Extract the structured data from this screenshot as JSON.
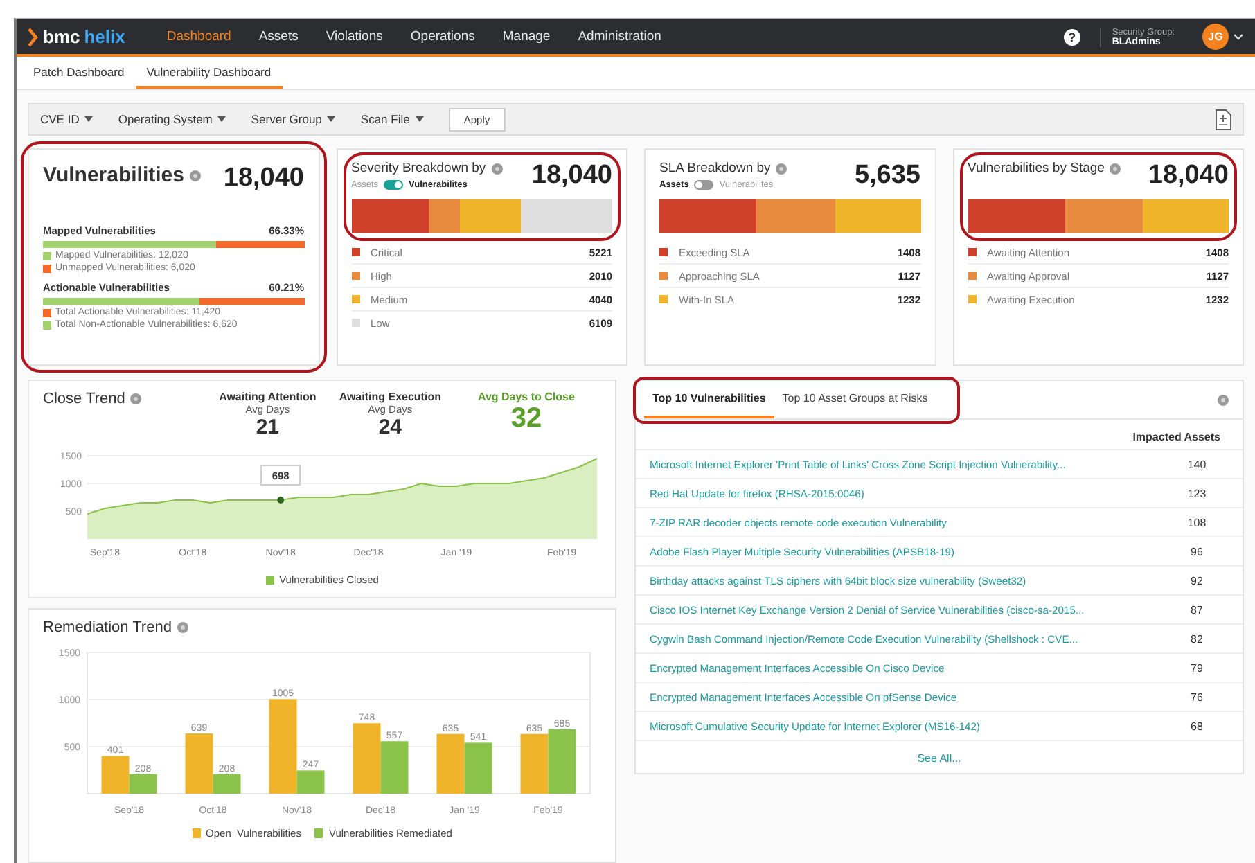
{
  "header": {
    "logo": {
      "brand": "bmc",
      "product": "helix"
    },
    "nav": [
      {
        "label": "Dashboard",
        "selected": true
      },
      {
        "label": "Assets",
        "selected": false
      },
      {
        "label": "Violations",
        "selected": false
      },
      {
        "label": "Operations",
        "selected": false
      },
      {
        "label": "Manage",
        "selected": false
      },
      {
        "label": "Administration",
        "selected": false
      }
    ],
    "help": "?",
    "security_group": {
      "label": "Security Group:",
      "value": "BLAdmins"
    },
    "avatar": "JG"
  },
  "subtabs": [
    {
      "label": "Patch Dashboard",
      "selected": false
    },
    {
      "label": "Vulnerability Dashboard",
      "selected": true
    }
  ],
  "filters": [
    {
      "label": "CVE ID"
    },
    {
      "label": "Operating System"
    },
    {
      "label": "Server Group"
    },
    {
      "label": "Scan File"
    }
  ],
  "apply": "Apply",
  "cards": [
    {
      "kind": "summary",
      "title": "Vulnerabilities",
      "total": "18,040",
      "highlighted": true,
      "sections": [
        {
          "title": "Mapped Vulnerabilities",
          "percent": "66.33%",
          "level": 0.6633,
          "legend": [
            {
              "label": "Mapped Vulnerabilities: 12,020",
              "color": "#a3d16e"
            },
            {
              "label": "Unmapped Vulnerabilities: 6,020",
              "color": "#f26b2a"
            }
          ]
        },
        {
          "title": "Actionable Vulnerabilities",
          "percent": "60.21%",
          "level": 0.6021,
          "legend": [
            {
              "label": "Total Actionable Vulnerabilities: 11,420",
              "color": "#f26b2a"
            },
            {
              "label": "Total Non-Actionable Vulnerabilities: 6,620",
              "color": "#a3d16e"
            }
          ]
        }
      ]
    },
    {
      "kind": "breakdown",
      "title": "Severity Breakdown by",
      "total": "18,040",
      "highlighted": true,
      "toggle": {
        "left": "Assets",
        "right": "Vulnerabilites",
        "on": true
      },
      "segments": [
        {
          "label": "Critical",
          "count": "5221",
          "color": "#d0402a"
        },
        {
          "label": "High",
          "count": "2010",
          "color": "#e88b3f"
        },
        {
          "label": "Medium",
          "count": "4040",
          "color": "#efb429"
        },
        {
          "label": "Low",
          "count": "6109",
          "color": "#dedede"
        }
      ]
    },
    {
      "kind": "breakdown",
      "title": "SLA Breakdown by",
      "total": "5,635",
      "highlighted": false,
      "toggle": {
        "left": "Assets",
        "right": "Vulnerabilites",
        "on": false
      },
      "segments": [
        {
          "label": "Exceeding SLA",
          "count": "1408",
          "color": "#d0402a"
        },
        {
          "label": "Approaching SLA",
          "count": "1127",
          "color": "#e88b3f"
        },
        {
          "label": "With-In SLA",
          "count": "1232",
          "color": "#efb429"
        }
      ]
    },
    {
      "kind": "breakdown",
      "title": "Vulnerabilities by Stage",
      "total": "18,040",
      "highlighted": true,
      "segments": [
        {
          "label": "Awaiting Attention",
          "count": "1408",
          "color": "#d0402a"
        },
        {
          "label": "Awaiting Approval",
          "count": "1127",
          "color": "#e88b3f"
        },
        {
          "label": "Awaiting Execution",
          "count": "1232",
          "color": "#efb429"
        }
      ]
    }
  ],
  "close_trend": {
    "title": "Close Trend",
    "stats": [
      {
        "kind": "plain",
        "label": "Awaiting Attention",
        "sublabel": "Avg Days",
        "value": "21"
      },
      {
        "kind": "plain",
        "label": "Awaiting Execution",
        "sublabel": "Avg Days",
        "value": "24"
      },
      {
        "kind": "accent",
        "label": "Avg Days to Close",
        "value": "32"
      }
    ],
    "chart_data": {
      "type": "area",
      "categories": [
        null,
        "Sep'18",
        null,
        null,
        null,
        null,
        "Oct'18",
        null,
        null,
        null,
        null,
        "Nov'18",
        null,
        null,
        null,
        null,
        "Dec'18",
        null,
        null,
        null,
        null,
        "Jan '19",
        null,
        null,
        null,
        null,
        null,
        "Feb'19",
        null,
        null
      ],
      "series": [
        {
          "name": "Vulnerabilities Closed",
          "color": "#8bc34a",
          "values": [
            450,
            550,
            600,
            650,
            650,
            700,
            700,
            650,
            700,
            700,
            700,
            700,
            750,
            750,
            750,
            800,
            800,
            850,
            900,
            1000,
            950,
            950,
            1000,
            1000,
            1000,
            1050,
            1100,
            1200,
            1300,
            1450
          ]
        }
      ],
      "ylim": [
        0,
        1500
      ],
      "yticks": [
        500,
        1000,
        1500
      ],
      "annotations": [
        {
          "x": "Nov'18",
          "text": "698"
        }
      ]
    }
  },
  "remediation": {
    "title": "Remediation Trend",
    "chart_data": {
      "type": "bar",
      "categories": [
        "Sep'18",
        "Oct'18",
        "Nov'18",
        "Dec'18",
        "Jan '19",
        "Feb'19"
      ],
      "series": [
        {
          "name": "Open  Vulnerabilities",
          "color": "#efb429",
          "values": [
            401,
            639,
            1005,
            748,
            635,
            635
          ]
        },
        {
          "name": "Vulnerabilities Remediated",
          "color": "#8bc34a",
          "values": [
            208,
            208,
            247,
            557,
            541,
            685
          ]
        }
      ],
      "ylim": [
        0,
        1500
      ],
      "yticks": [
        500,
        1000,
        1500
      ],
      "data_labels": true
    }
  },
  "top10": {
    "tabs": [
      {
        "label": "Top 10 Vulnerabilities",
        "selected": true
      },
      {
        "label": "Top 10 Asset Groups at Risks",
        "selected": false
      }
    ],
    "highlighted": true,
    "column": "Impacted Assets",
    "rows": [
      {
        "name": "Microsoft Internet Explorer 'Print Table of Links' Cross Zone Script Injection Vulnerability...",
        "count": "140"
      },
      {
        "name": "Red Hat Update for firefox (RHSA-2015:0046)",
        "count": "123"
      },
      {
        "name": "7-ZIP RAR decoder objects remote code execution Vulnerability",
        "count": "108"
      },
      {
        "name": "Adobe Flash Player Multiple Security Vulnerabilities (APSB18-19)",
        "count": "96"
      },
      {
        "name": "Birthday attacks against TLS ciphers with 64bit block size vulnerability (Sweet32)",
        "count": "92"
      },
      {
        "name": "Cisco IOS Internet Key Exchange Version 2 Denial of Service Vulnerabilities (cisco-sa-2015...",
        "count": "87"
      },
      {
        "name": "Cygwin Bash Command Injection/Remote Code Execution Vulnerability (Shellshock : CVE...",
        "count": "82"
      },
      {
        "name": "Encrypted Management Interfaces Accessible On Cisco Device",
        "count": "79"
      },
      {
        "name": "Encrypted Management Interfaces Accessible On pfSense Device",
        "count": "76"
      },
      {
        "name": "Microsoft Cumulative Security Update for Internet Explorer (MS16-142)",
        "count": "68"
      }
    ],
    "see_all": "See All..."
  }
}
